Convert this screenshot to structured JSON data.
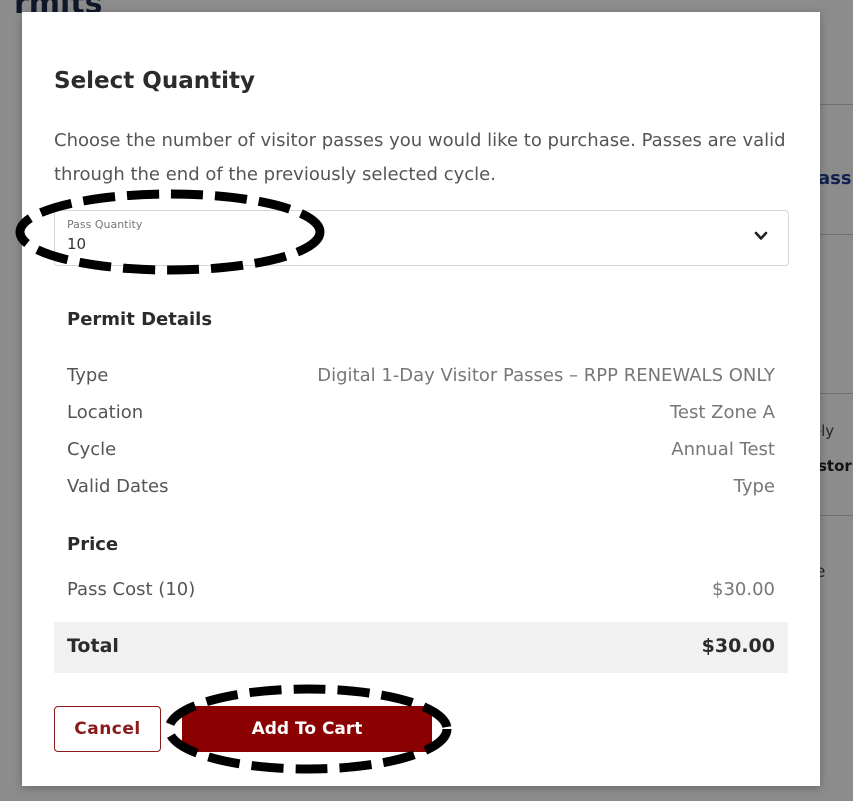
{
  "background": {
    "title_fragment": "rmits",
    "link_fragment": "ass",
    "text_fragment_1": "tely",
    "text_fragment_2": "stor",
    "text_fragment_3": "e"
  },
  "modal": {
    "title": "Select Quantity",
    "description": "Choose the number of visitor passes you would like to purchase. Passes are valid through the end of the previously selected cycle.",
    "quantity": {
      "label": "Pass Quantity",
      "value": "10",
      "icon": "chevron-down-icon"
    },
    "permit_details": {
      "heading": "Permit Details",
      "rows": [
        {
          "label": "Type",
          "value": "Digital 1-Day Visitor Passes – RPP RENEWALS ONLY"
        },
        {
          "label": "Location",
          "value": "Test Zone A"
        },
        {
          "label": "Cycle",
          "value": "Annual Test"
        },
        {
          "label": "Valid Dates",
          "value": "Type"
        }
      ]
    },
    "price": {
      "heading": "Price",
      "pass_cost_label": "Pass Cost (10)",
      "pass_cost_value": "$30.00",
      "total_label": "Total",
      "total_value": "$30.00"
    },
    "buttons": {
      "cancel": "Cancel",
      "add_to_cart": "Add To Cart"
    }
  },
  "colors": {
    "primary_button": "#8b0000",
    "cancel_border": "#8b1a1a",
    "overlay": "#8b8b8b"
  }
}
